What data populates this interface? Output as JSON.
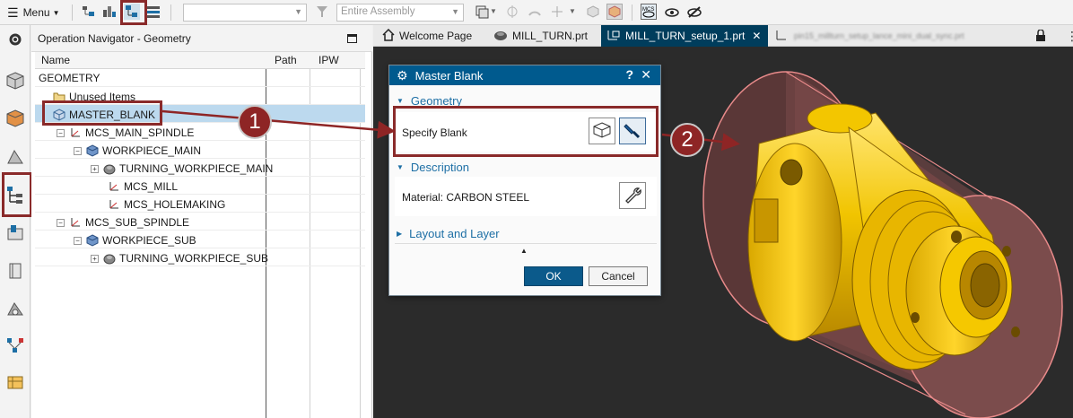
{
  "toolbar": {
    "menu_label": "Menu",
    "filter_placeholder": "",
    "scope_value": "Entire Assembly"
  },
  "navigator": {
    "title": "Operation Navigator - Geometry",
    "columns": [
      "Name",
      "Path",
      "IPW"
    ],
    "rows": [
      {
        "label": "GEOMETRY",
        "level": 0,
        "toggle": "",
        "icon": "none"
      },
      {
        "label": "Unused Items",
        "level": 1,
        "toggle": "",
        "icon": "folder-icon"
      },
      {
        "label": "MASTER_BLANK",
        "level": 1,
        "toggle": "",
        "icon": "blank-icon",
        "selected": true
      },
      {
        "label": "MCS_MAIN_SPINDLE",
        "level": 1,
        "toggle": "−",
        "icon": "mcs-icon"
      },
      {
        "label": "WORKPIECE_MAIN",
        "level": 2,
        "toggle": "−",
        "icon": "workpiece-icon"
      },
      {
        "label": "TURNING_WORKPIECE_MAIN",
        "level": 3,
        "toggle": "+",
        "icon": "turning-workpiece-icon"
      },
      {
        "label": "MCS_MILL",
        "level": 3,
        "toggle": "",
        "icon": "mcs-icon"
      },
      {
        "label": "MCS_HOLEMAKING",
        "level": 3,
        "toggle": "",
        "icon": "mcs-icon"
      },
      {
        "label": "MCS_SUB_SPINDLE",
        "level": 1,
        "toggle": "−",
        "icon": "mcs-icon"
      },
      {
        "label": "WORKPIECE_SUB",
        "level": 2,
        "toggle": "−",
        "icon": "workpiece-icon"
      },
      {
        "label": "TURNING_WORKPIECE_SUB",
        "level": 3,
        "toggle": "+",
        "icon": "turning-workpiece-icon"
      }
    ]
  },
  "tabs": [
    {
      "label": "Welcome Page",
      "icon": "home-icon"
    },
    {
      "label": "MILL_TURN.prt",
      "icon": "part-icon"
    },
    {
      "label": "MILL_TURN_setup_1.prt",
      "icon": "setup-part-icon",
      "active": true
    },
    {
      "label": "pin15_millturn_setup_lance_mini_dual_sync.prt",
      "icon": "part-icon"
    }
  ],
  "dialog": {
    "title": "Master Blank",
    "help": "?",
    "close": "✕",
    "geometry_section": "Geometry",
    "specify_blank_label": "Specify Blank",
    "description_section": "Description",
    "material_label": "Material: CARBON STEEL",
    "layout_section": "Layout and Layer",
    "ok_label": "OK",
    "cancel_label": "Cancel"
  },
  "callouts": [
    "1",
    "2"
  ],
  "colors": {
    "accent": "#005a8e",
    "active_tab": "#003d5c",
    "selection": "#bcd9ee",
    "callout": "#8e2525",
    "graphics_bg": "#2b2b2b",
    "part_gold": "#e8b800"
  }
}
